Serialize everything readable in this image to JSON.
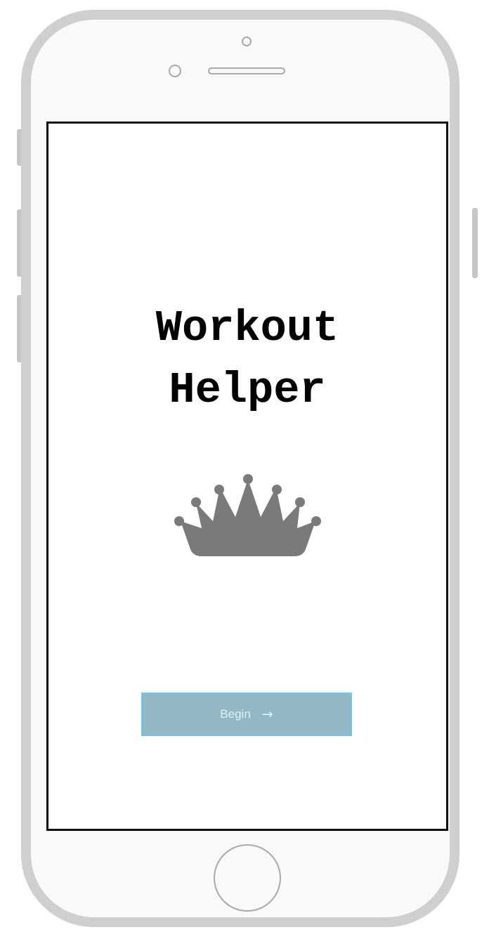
{
  "app": {
    "title_line1": "Workout",
    "title_line2": "Helper",
    "logo_icon": "crown-icon",
    "logo_color": "#7a7a7a"
  },
  "begin_button": {
    "label": "Begin",
    "arrow": "→",
    "arrow_icon": "arrow-right-icon",
    "background": "#93b8c3",
    "border": "#6fc6ec",
    "text_color": "#ddf2fa"
  },
  "device": {
    "frame_color": "#cfcfcf",
    "body_color": "#f9f9f9"
  }
}
